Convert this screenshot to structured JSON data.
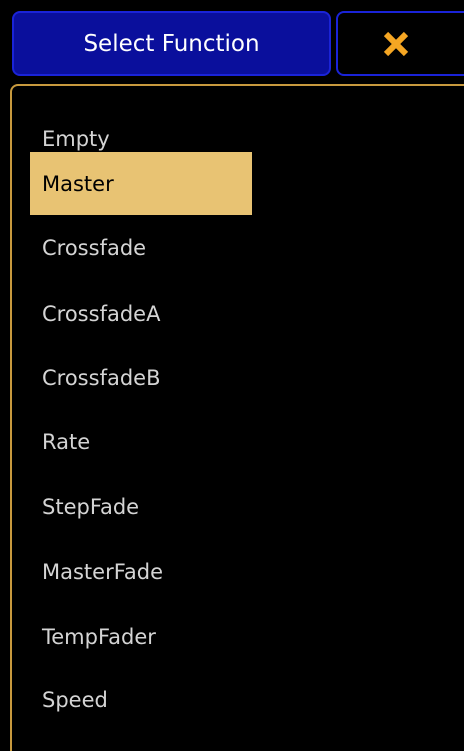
{
  "header": {
    "title": "Select Function",
    "close_icon": "close-icon",
    "accent_color": "#f5a623"
  },
  "colors": {
    "title_bg": "#0a0f9c",
    "border_blue": "#1a23d8",
    "panel_border": "#c89a3e",
    "selected_bg": "#e8c373",
    "item_text": "#d4d4d4"
  },
  "list": {
    "selected_index": 1,
    "items": [
      {
        "label": "Empty"
      },
      {
        "label": "Master"
      },
      {
        "label": "Crossfade"
      },
      {
        "label": "CrossfadeA"
      },
      {
        "label": "CrossfadeB"
      },
      {
        "label": "Rate"
      },
      {
        "label": "StepFade"
      },
      {
        "label": "MasterFade"
      },
      {
        "label": "TempFader"
      },
      {
        "label": "Speed"
      }
    ]
  }
}
